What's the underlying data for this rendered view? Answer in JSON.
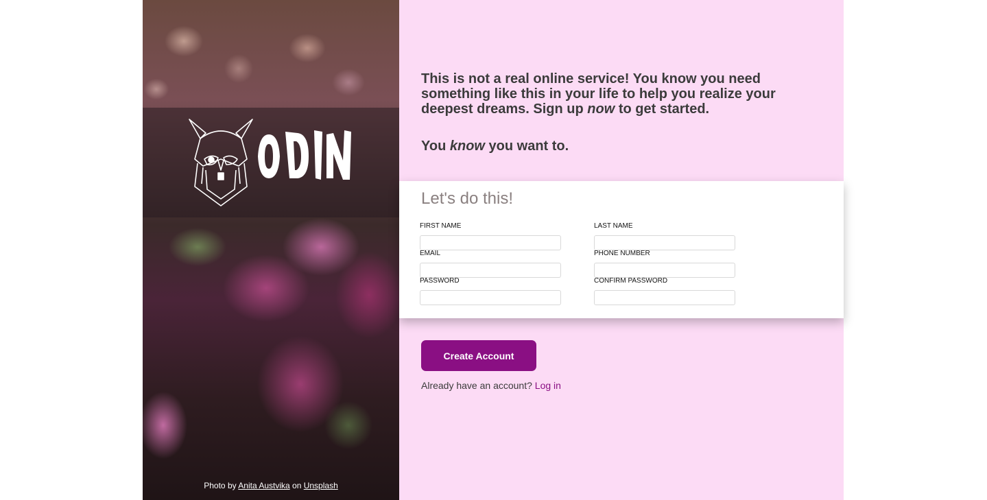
{
  "brand": {
    "logo_text": "ODIN",
    "logo_icon": "viking-helmet-icon"
  },
  "photo_credit": {
    "prefix": "Photo by",
    "author": "Anita Austvika",
    "middle": "on",
    "source": "Unsplash"
  },
  "intro": {
    "line_start": "This is not a real online service! You know you need something like this in your life to help you realize your deepest dreams. Sign up",
    "line_emph": "now",
    "line_end": "to get started.",
    "tag_start": "You",
    "tag_emph": "know",
    "tag_end": "you want to."
  },
  "form": {
    "title": "Let's do this!",
    "fields": {
      "first_name": {
        "label": "FIRST NAME",
        "value": ""
      },
      "last_name": {
        "label": "LAST NAME",
        "value": ""
      },
      "email": {
        "label": "EMAIL",
        "value": ""
      },
      "phone": {
        "label": "PHONE NUMBER",
        "value": ""
      },
      "password": {
        "label": "PASSWORD",
        "value": ""
      },
      "confirm_password": {
        "label": "CONFIRM PASSWORD",
        "value": ""
      }
    }
  },
  "actions": {
    "create_label": "Create Account",
    "login_prompt": "Already have an account?",
    "login_link": "Log in"
  },
  "colors": {
    "accent": "#8a0f83",
    "panel_bg": "#fcdbf5"
  }
}
